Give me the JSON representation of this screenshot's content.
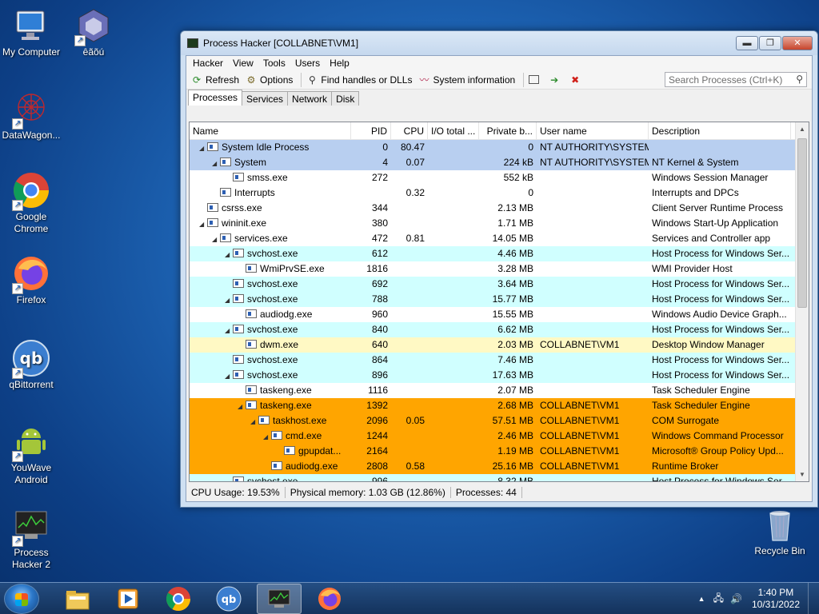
{
  "desktop": {
    "icons": [
      {
        "label": "My Computer",
        "icon": "computer-icon"
      },
      {
        "label": "êãõú",
        "icon": "cube-icon"
      },
      {
        "label": "DataWagon...",
        "icon": "network-graph-icon"
      },
      {
        "label": "Google Chrome",
        "icon": "chrome-icon"
      },
      {
        "label": "Firefox",
        "icon": "firefox-icon"
      },
      {
        "label": "qBittorrent",
        "icon": "qbittorrent-icon"
      },
      {
        "label": "YouWave Android",
        "icon": "android-icon"
      },
      {
        "label": "Process Hacker 2",
        "icon": "process-hacker-icon"
      },
      {
        "label": "Recycle Bin",
        "icon": "recycle-bin-icon"
      }
    ]
  },
  "window": {
    "title": "Process Hacker [COLLABNET\\VM1]",
    "controls": {
      "minimize": "▬",
      "maximize": "❐",
      "close": "✕"
    }
  },
  "menu": [
    "Hacker",
    "View",
    "Tools",
    "Users",
    "Help"
  ],
  "toolbar": {
    "refresh": "Refresh",
    "options": "Options",
    "find_handles": "Find handles or DLLs",
    "system_info": "System information",
    "search_placeholder": "Search Processes (Ctrl+K)"
  },
  "tabs": [
    "Processes",
    "Services",
    "Network",
    "Disk"
  ],
  "columns": {
    "name": "Name",
    "pid": "PID",
    "cpu": "CPU",
    "io": "I/O total ...",
    "priv": "Private b...",
    "user": "User name",
    "desc": "Description"
  },
  "colors": {
    "system": "#b8cff0",
    "service": "#d0ffff",
    "own": "#fff9c4",
    "selected_suspended": "#ffa500",
    "white": "#ffffff"
  },
  "processes": [
    {
      "name": "System Idle Process",
      "indent": 0,
      "tri": "◢",
      "pid": "0",
      "cpu": "80.47",
      "io": "",
      "priv": "0",
      "user": "NT AUTHORITY\\SYSTEM",
      "desc": "",
      "color": "system"
    },
    {
      "name": "System",
      "indent": 1,
      "tri": "◢",
      "pid": "4",
      "cpu": "0.07",
      "io": "",
      "priv": "224 kB",
      "user": "NT AUTHORITY\\SYSTEM",
      "desc": "NT Kernel & System",
      "color": "system"
    },
    {
      "name": "smss.exe",
      "indent": 2,
      "tri": "",
      "pid": "272",
      "cpu": "",
      "io": "",
      "priv": "552 kB",
      "user": "",
      "desc": "Windows Session Manager",
      "color": "white"
    },
    {
      "name": "Interrupts",
      "indent": 1,
      "tri": "",
      "pid": "",
      "cpu": "0.32",
      "io": "",
      "priv": "0",
      "user": "",
      "desc": "Interrupts and DPCs",
      "color": "white"
    },
    {
      "name": "csrss.exe",
      "indent": 0,
      "tri": "",
      "pid": "344",
      "cpu": "",
      "io": "",
      "priv": "2.13 MB",
      "user": "",
      "desc": "Client Server Runtime Process",
      "color": "white"
    },
    {
      "name": "wininit.exe",
      "indent": 0,
      "tri": "◢",
      "pid": "380",
      "cpu": "",
      "io": "",
      "priv": "1.71 MB",
      "user": "",
      "desc": "Windows Start-Up Application",
      "color": "white"
    },
    {
      "name": "services.exe",
      "indent": 1,
      "tri": "◢",
      "pid": "472",
      "cpu": "0.81",
      "io": "",
      "priv": "14.05 MB",
      "user": "",
      "desc": "Services and Controller app",
      "color": "white"
    },
    {
      "name": "svchost.exe",
      "indent": 2,
      "tri": "◢",
      "pid": "612",
      "cpu": "",
      "io": "",
      "priv": "4.46 MB",
      "user": "",
      "desc": "Host Process for Windows Ser...",
      "color": "service"
    },
    {
      "name": "WmiPrvSE.exe",
      "indent": 3,
      "tri": "",
      "pid": "1816",
      "cpu": "",
      "io": "",
      "priv": "3.28 MB",
      "user": "",
      "desc": "WMI Provider Host",
      "color": "white"
    },
    {
      "name": "svchost.exe",
      "indent": 2,
      "tri": "",
      "pid": "692",
      "cpu": "",
      "io": "",
      "priv": "3.64 MB",
      "user": "",
      "desc": "Host Process for Windows Ser...",
      "color": "service"
    },
    {
      "name": "svchost.exe",
      "indent": 2,
      "tri": "◢",
      "pid": "788",
      "cpu": "",
      "io": "",
      "priv": "15.77 MB",
      "user": "",
      "desc": "Host Process for Windows Ser...",
      "color": "service"
    },
    {
      "name": "audiodg.exe",
      "indent": 3,
      "tri": "",
      "pid": "960",
      "cpu": "",
      "io": "",
      "priv": "15.55 MB",
      "user": "",
      "desc": "Windows Audio Device Graph...",
      "color": "white"
    },
    {
      "name": "svchost.exe",
      "indent": 2,
      "tri": "◢",
      "pid": "840",
      "cpu": "",
      "io": "",
      "priv": "6.62 MB",
      "user": "",
      "desc": "Host Process for Windows Ser...",
      "color": "service"
    },
    {
      "name": "dwm.exe",
      "indent": 3,
      "tri": "",
      "pid": "640",
      "cpu": "",
      "io": "",
      "priv": "2.03 MB",
      "user": "COLLABNET\\VM1",
      "desc": "Desktop Window Manager",
      "color": "own"
    },
    {
      "name": "svchost.exe",
      "indent": 2,
      "tri": "",
      "pid": "864",
      "cpu": "",
      "io": "",
      "priv": "7.46 MB",
      "user": "",
      "desc": "Host Process for Windows Ser...",
      "color": "service"
    },
    {
      "name": "svchost.exe",
      "indent": 2,
      "tri": "◢",
      "pid": "896",
      "cpu": "",
      "io": "",
      "priv": "17.63 MB",
      "user": "",
      "desc": "Host Process for Windows Ser...",
      "color": "service"
    },
    {
      "name": "taskeng.exe",
      "indent": 3,
      "tri": "",
      "pid": "1116",
      "cpu": "",
      "io": "",
      "priv": "2.07 MB",
      "user": "",
      "desc": "Task Scheduler Engine",
      "color": "white"
    },
    {
      "name": "taskeng.exe",
      "indent": 3,
      "tri": "◢",
      "pid": "1392",
      "cpu": "",
      "io": "",
      "priv": "2.68 MB",
      "user": "COLLABNET\\VM1",
      "desc": "Task Scheduler Engine",
      "color": "selected_suspended"
    },
    {
      "name": "taskhost.exe",
      "indent": 4,
      "tri": "◢",
      "pid": "2096",
      "cpu": "0.05",
      "io": "",
      "priv": "57.51 MB",
      "user": "COLLABNET\\VM1",
      "desc": "COM Surrogate",
      "color": "selected_suspended"
    },
    {
      "name": "cmd.exe",
      "indent": 5,
      "tri": "◢",
      "pid": "1244",
      "cpu": "",
      "io": "",
      "priv": "2.46 MB",
      "user": "COLLABNET\\VM1",
      "desc": "Windows Command Processor",
      "color": "selected_suspended"
    },
    {
      "name": "gpupdat...",
      "indent": 6,
      "tri": "",
      "pid": "2164",
      "cpu": "",
      "io": "",
      "priv": "1.19 MB",
      "user": "COLLABNET\\VM1",
      "desc": "Microsoft® Group Policy Upd...",
      "color": "selected_suspended"
    },
    {
      "name": "audiodg.exe",
      "indent": 5,
      "tri": "",
      "pid": "2808",
      "cpu": "0.58",
      "io": "",
      "priv": "25.16 MB",
      "user": "COLLABNET\\VM1",
      "desc": "Runtime Broker",
      "color": "selected_suspended"
    },
    {
      "name": "svchost.exe",
      "indent": 2,
      "tri": "",
      "pid": "996",
      "cpu": "",
      "io": "",
      "priv": "8.32 MB",
      "user": "",
      "desc": "Host Process for Windows Ser...",
      "color": "service"
    }
  ],
  "status": {
    "cpu": "CPU Usage: 19.53%",
    "memory": "Physical memory: 1.03 GB (12.86%)",
    "processes": "Processes: 44"
  },
  "taskbar": {
    "apps": [
      "explorer-icon",
      "media-player-icon",
      "chrome-icon",
      "qbittorrent-icon",
      "process-hacker-icon",
      "firefox-icon"
    ],
    "time": "1:40 PM",
    "date": "10/31/2022"
  }
}
